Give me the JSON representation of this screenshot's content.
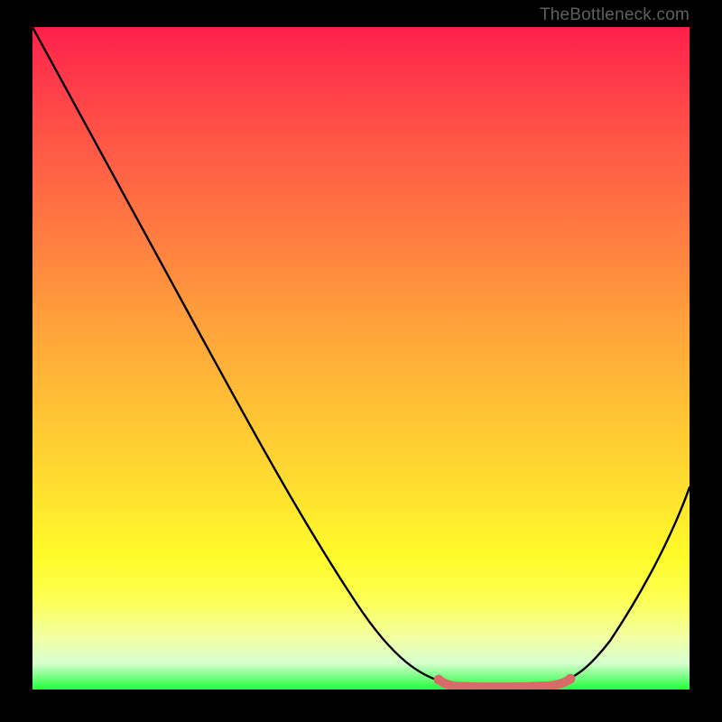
{
  "attribution": "TheBottleneck.com",
  "colors": {
    "page_bg": "#000000",
    "curve": "#000000",
    "marker": "#d96a6a"
  },
  "chart_data": {
    "type": "line",
    "title": "",
    "xlabel": "",
    "ylabel": "",
    "xlim": [
      0,
      100
    ],
    "ylim": [
      0,
      100
    ],
    "grid": false,
    "legend": false,
    "series": [
      {
        "name": "bottleneck_curve",
        "x": [
          0,
          5,
          10,
          15,
          20,
          25,
          30,
          35,
          40,
          45,
          50,
          55,
          58,
          60,
          62,
          65,
          70,
          75,
          80,
          82,
          85,
          90,
          95,
          100
        ],
        "values": [
          100,
          92,
          84,
          76,
          68,
          60,
          52,
          44,
          36,
          28,
          20,
          12,
          8,
          5,
          3,
          1,
          0,
          0,
          0,
          1,
          3,
          11,
          22,
          34
        ]
      }
    ],
    "markers": [
      {
        "name": "flat_min_highlight",
        "x_start": 62,
        "x_end": 82,
        "y": 0.6
      }
    ],
    "background_gradient": {
      "top": "#ff1f4a",
      "mid": "#ffe02f",
      "bottom": "#1cff3e"
    }
  }
}
